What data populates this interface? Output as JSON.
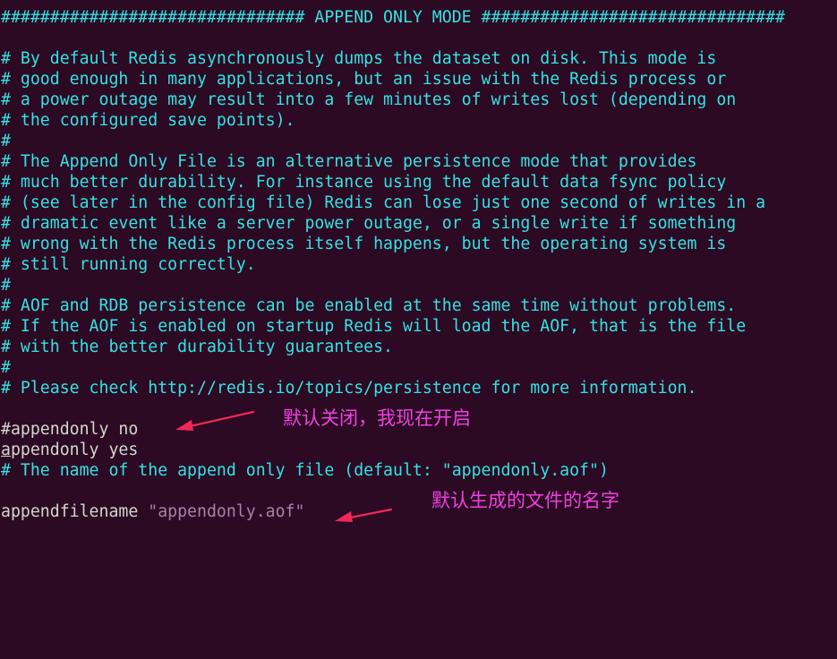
{
  "lines": [
    {
      "text": "############################### APPEND ONLY MODE ###############################",
      "kind": "comment"
    },
    {
      "text": "",
      "kind": "comment"
    },
    {
      "text": "# By default Redis asynchronously dumps the dataset on disk. This mode is",
      "kind": "comment"
    },
    {
      "text": "# good enough in many applications, but an issue with the Redis process or",
      "kind": "comment"
    },
    {
      "text": "# a power outage may result into a few minutes of writes lost (depending on",
      "kind": "comment"
    },
    {
      "text": "# the configured save points).",
      "kind": "comment"
    },
    {
      "text": "#",
      "kind": "comment"
    },
    {
      "text": "# The Append Only File is an alternative persistence mode that provides",
      "kind": "comment"
    },
    {
      "text": "# much better durability. For instance using the default data fsync policy",
      "kind": "comment"
    },
    {
      "text": "# (see later in the config file) Redis can lose just one second of writes in a",
      "kind": "comment"
    },
    {
      "text": "# dramatic event like a server power outage, or a single write if something",
      "kind": "comment"
    },
    {
      "text": "# wrong with the Redis process itself happens, but the operating system is",
      "kind": "comment"
    },
    {
      "text": "# still running correctly.",
      "kind": "comment"
    },
    {
      "text": "#",
      "kind": "comment"
    },
    {
      "text": "# AOF and RDB persistence can be enabled at the same time without problems.",
      "kind": "comment"
    },
    {
      "text": "# If the AOF is enabled on startup Redis will load the AOF, that is the file",
      "kind": "comment"
    },
    {
      "text": "# with the better durability guarantees.",
      "kind": "comment"
    },
    {
      "text": "#",
      "kind": "comment"
    },
    {
      "text": "# Please check http://redis.io/topics/persistence for more information.",
      "kind": "comment"
    },
    {
      "text": "",
      "kind": "comment"
    },
    {
      "text": "#appendonly no",
      "kind": "plain"
    },
    {
      "text": "ppendonly yes",
      "kind": "plain",
      "cursor_char": "a"
    },
    {
      "text": "# The name of the append only file (default: \"appendonly.aof\")",
      "kind": "comment"
    },
    {
      "text": "",
      "kind": "comment"
    },
    {
      "text": "appendfilename ",
      "kind": "plain",
      "string_part": "\"appendonly.aof\""
    }
  ],
  "annotations": {
    "appendonly_note": "默认关闭，我现在开启",
    "filename_note": "默认生成的文件的名字"
  },
  "colors": {
    "background": "#2c0a24",
    "comment": "#34e2e2",
    "plain": "#d3d7cf",
    "string": "#ad7fa8",
    "annotation": "#f040e0",
    "arrow": "#f0285a"
  }
}
